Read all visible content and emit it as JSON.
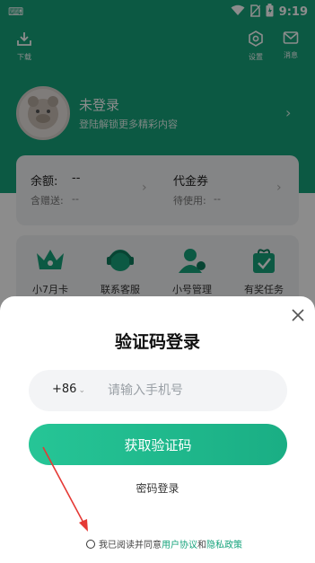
{
  "status_bar": {
    "time": "9:19",
    "left_icon": "keyboard-icon",
    "icons": [
      "wifi-icon",
      "no-sim-icon",
      "battery-icon"
    ]
  },
  "top_bar": {
    "download_label": "下载",
    "settings_label": "设置",
    "message_label": "消息"
  },
  "profile": {
    "name": "未登录",
    "subtitle": "登陆解锁更多精彩内容"
  },
  "balance": {
    "balance_label": "余额:",
    "balance_value": "--",
    "gift_label": "含赠送:",
    "gift_value": "--",
    "voucher_label": "代金券",
    "voucher_pending_label": "待使用:",
    "voucher_pending_value": "--"
  },
  "services": [
    {
      "label": "小7月卡",
      "icon": "crown-icon"
    },
    {
      "label": "联系客服",
      "icon": "customer-service-icon"
    },
    {
      "label": "小号管理",
      "icon": "account-management-icon"
    },
    {
      "label": "有奖任务",
      "icon": "gift-task-icon"
    }
  ],
  "login_sheet": {
    "title": "验证码登录",
    "country_code": "+86",
    "phone_placeholder": "请输入手机号",
    "get_code_button": "获取验证码",
    "password_login": "密码登录",
    "agree_prefix": "我已阅读并同意",
    "user_agreement": "用户协议",
    "and": "和",
    "privacy_policy": "隐私政策"
  },
  "colors": {
    "brand_green": "#17a37b",
    "button_green": "#26c596",
    "annotation_arrow": "#e53935"
  }
}
